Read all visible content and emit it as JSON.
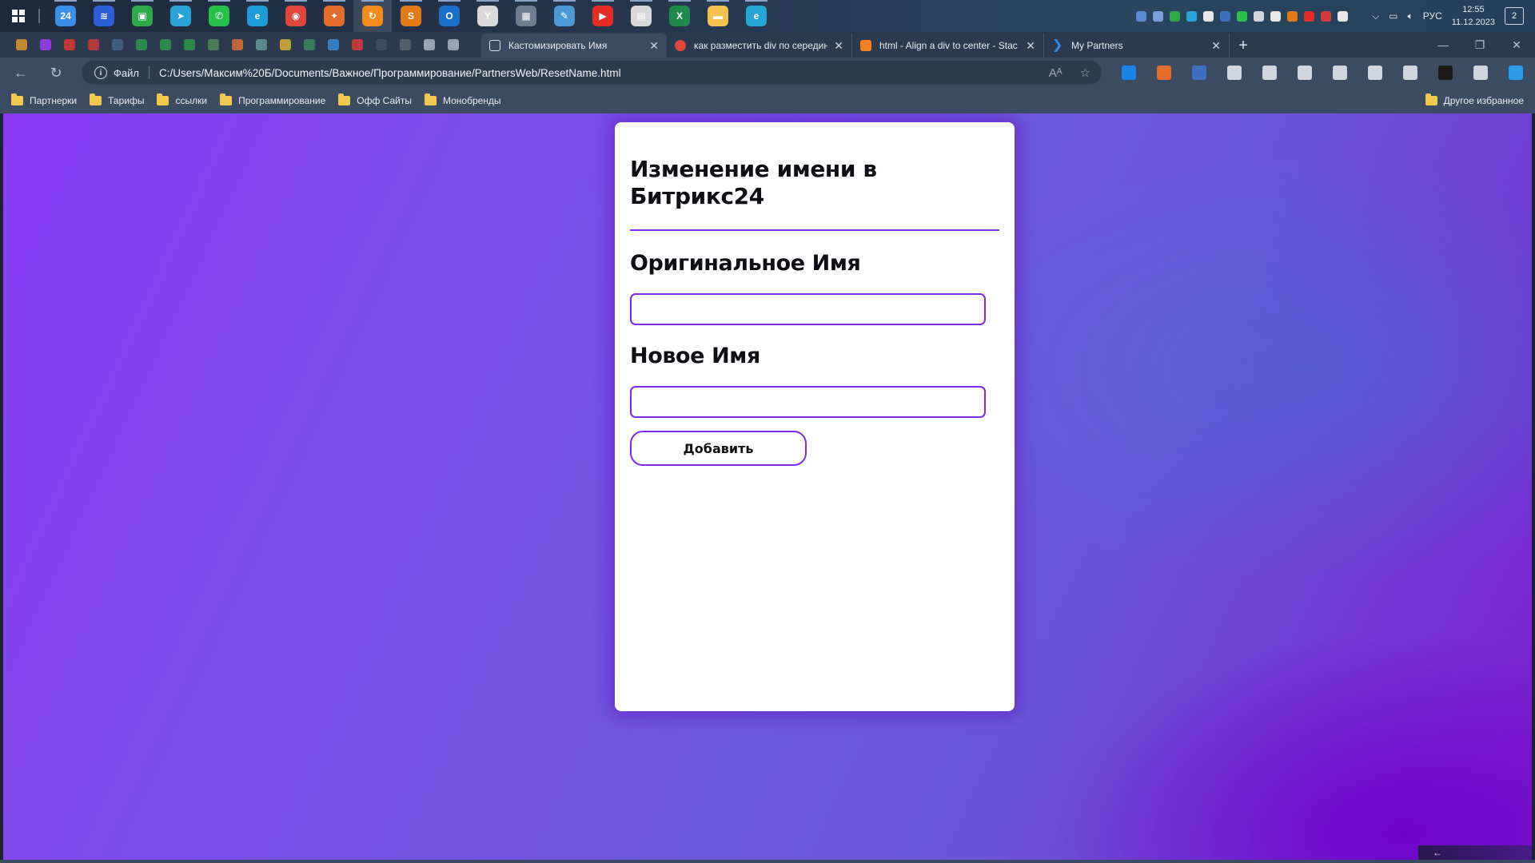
{
  "taskbar": {
    "apps": [
      {
        "name": "bitrix24-app-icon",
        "color": "#3a8ee6",
        "glyph": "24"
      },
      {
        "name": "stack-app-icon",
        "color": "#2b5ed8",
        "glyph": "≋"
      },
      {
        "name": "monitor-app-icon",
        "color": "#2eaa4a",
        "glyph": "▣"
      },
      {
        "name": "telegram-app-icon",
        "color": "#2aa3dd",
        "glyph": "➤"
      },
      {
        "name": "whatsapp-app-icon",
        "color": "#27c04b",
        "glyph": "✆"
      },
      {
        "name": "edge-app-icon",
        "color": "#1b9bd7",
        "glyph": "e"
      },
      {
        "name": "chrome-app-icon",
        "color": "#e0463b",
        "glyph": "◉"
      },
      {
        "name": "rocket-app-icon",
        "color": "#e36d2a",
        "glyph": "✦"
      },
      {
        "name": "refresh-app-icon",
        "color": "#f28c1c",
        "glyph": "↻"
      },
      {
        "name": "sublime-app-icon",
        "color": "#e27a18",
        "glyph": "S"
      },
      {
        "name": "outlook-app-icon",
        "color": "#1a6fc9",
        "glyph": "O"
      },
      {
        "name": "yandex-browser-app-icon",
        "color": "#d9d9d9",
        "glyph": "Y"
      },
      {
        "name": "calculator-app-icon",
        "color": "#6f7d90",
        "glyph": "▦"
      },
      {
        "name": "notes-app-icon",
        "color": "#4d9ad6",
        "glyph": "✎"
      },
      {
        "name": "youtube-app-icon",
        "color": "#e52d27",
        "glyph": "▶"
      },
      {
        "name": "files-app-icon",
        "color": "#d8d8d8",
        "glyph": "▤"
      },
      {
        "name": "excel-app-icon",
        "color": "#1f8a4c",
        "glyph": "X"
      },
      {
        "name": "explorer-app-icon",
        "color": "#f2c14e",
        "glyph": "▬"
      },
      {
        "name": "edge-beta-app-icon",
        "color": "#25a6d9",
        "glyph": "e"
      }
    ],
    "tray_icons": [
      "#5b89d6",
      "#7aa0e0",
      "#2eaa4a",
      "#2aa3dd",
      "#e8e8e8",
      "#3d6fc2",
      "#27c04b",
      "#cfd6e0",
      "#e8e8e8",
      "#e27a18",
      "#e52d27",
      "#d13b3b",
      "#e8e8e8"
    ],
    "language": "РУС",
    "time": "12:55",
    "date": "11.12.2023",
    "notifications": "2"
  },
  "tabs": {
    "pinned": [
      "#c08a2e",
      "#8b3fd8",
      "#c23636",
      "#b23a3a",
      "#3e5e7c",
      "#2a8a4c",
      "#2a8a4c",
      "#2a8a4c",
      "#4a7c5a",
      "#c0663a",
      "#5b8a8a",
      "#c0a03a",
      "#3a7c5a",
      "#3a7cc0",
      "#c03a3a",
      "#3a4c60",
      "#555f6c",
      "#9aa4b0",
      "#9aa4b0"
    ],
    "open": [
      {
        "title": "Кастомизировать Имя",
        "active": true,
        "fav_color": "#d8dee6"
      },
      {
        "title": "как разместить div по середине",
        "active": false,
        "fav_color": "#e0463b"
      },
      {
        "title": "html - Align a div to center - Stac",
        "active": false,
        "fav_color": "#f48024"
      },
      {
        "title": "My Partners",
        "active": false,
        "fav_color": "#2b8cf0"
      }
    ]
  },
  "address_bar": {
    "scheme_label": "Файл",
    "url": "C:/Users/Максим%20Б/Documents/Важное/Программирование/PartnersWeb/ResetName.html"
  },
  "extensions": [
    "#1b82e6",
    "#e36d2a",
    "#3d6fc2",
    "#cfd6e0",
    "#cfd6e0",
    "#cfd6e0",
    "#cfd6e0",
    "#cfd6e0",
    "#cfd6e0",
    "#1a1a1a",
    "#cfd6e0",
    "#2b9ae8"
  ],
  "bookmarks": {
    "items": [
      "Партнерки",
      "Тарифы",
      "ссылки",
      "Программирование",
      "Офф Сайты",
      "Монобренды"
    ],
    "other": "Другое избранное"
  },
  "page": {
    "title": "Изменение имени в Битрикс24",
    "original_label": "Оригинальное Имя",
    "original_value": "",
    "new_label": "Новое Имя",
    "new_value": "",
    "button_label": "Добавить",
    "corner_arrow": "←"
  },
  "colors": {
    "accent": "#7d2ae8",
    "background_start": "#8a3cf5",
    "background_end": "#7d1ed2"
  }
}
